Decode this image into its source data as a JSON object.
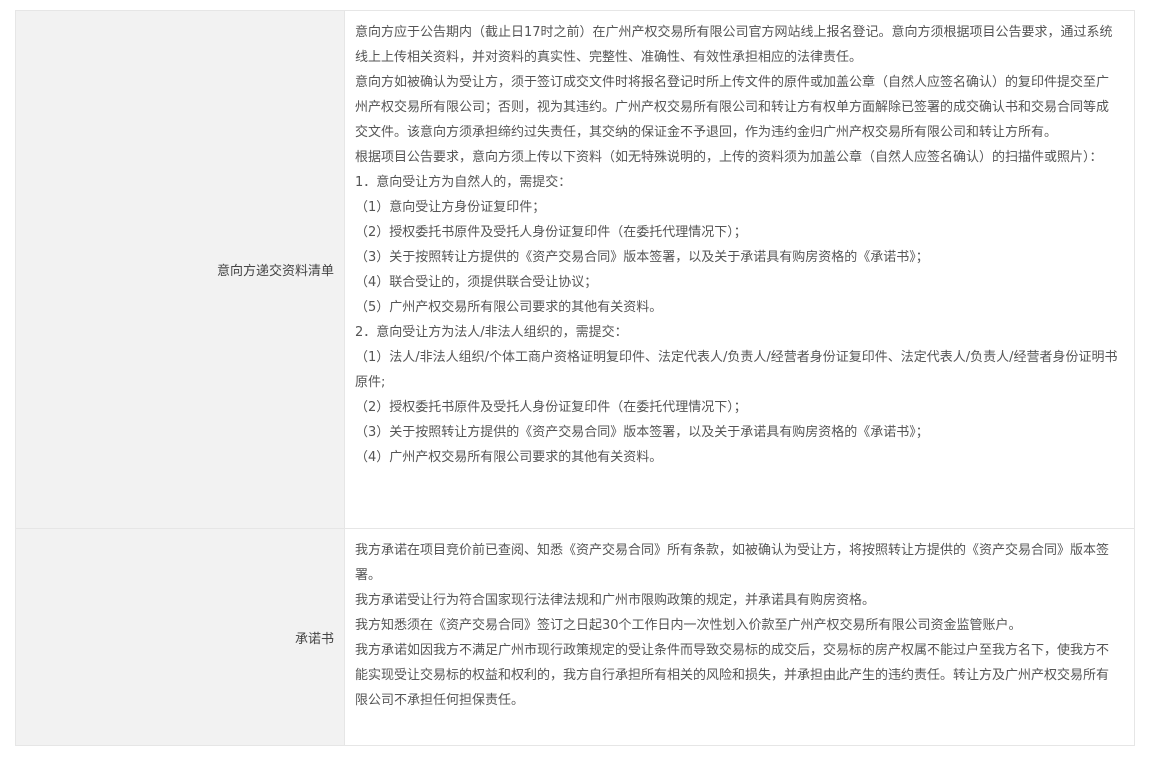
{
  "rows": [
    {
      "label": "意向方递交资料清单",
      "paragraphs": [
        "意向方应于公告期内（截止日17时之前）在广州产权交易所有限公司官方网站线上报名登记。意向方须根据项目公告要求，通过系统线上上传相关资料，并对资料的真实性、完整性、准确性、有效性承担相应的法律责任。",
        "意向方如被确认为受让方，须于签订成交文件时将报名登记时所上传文件的原件或加盖公章（自然人应签名确认）的复印件提交至广州产权交易所有限公司；否则，视为其违约。广州产权交易所有限公司和转让方有权单方面解除已签署的成交确认书和交易合同等成交文件。该意向方须承担缔约过失责任，其交纳的保证金不予退回，作为违约金归广州产权交易所有限公司和转让方所有。",
        "根据项目公告要求，意向方须上传以下资料（如无特殊说明的，上传的资料须为加盖公章（自然人应签名确认）的扫描件或照片）：",
        "1．意向受让方为自然人的，需提交：",
        "（1）意向受让方身份证复印件；",
        "（2）授权委托书原件及受托人身份证复印件（在委托代理情况下）；",
        "（3）关于按照转让方提供的《资产交易合同》版本签署，以及关于承诺具有购房资格的《承诺书》；",
        "（4）联合受让的，须提供联合受让协议；",
        "（5）广州产权交易所有限公司要求的其他有关资料。",
        "2．意向受让方为法人/非法人组织的，需提交：",
        "（1）法人/非法人组织/个体工商户资格证明复印件、法定代表人/负责人/经营者身份证复印件、法定代表人/负责人/经营者身份证明书原件;",
        "（2）授权委托书原件及受托人身份证复印件（在委托代理情况下）；",
        "（3）关于按照转让方提供的《资产交易合同》版本签署，以及关于承诺具有购房资格的《承诺书》；",
        "（4）广州产权交易所有限公司要求的其他有关资料。"
      ]
    },
    {
      "label": "承诺书",
      "paragraphs": [
        "我方承诺在项目竞价前已查阅、知悉《资产交易合同》所有条款，如被确认为受让方，将按照转让方提供的《资产交易合同》版本签署。",
        "我方承诺受让行为符合国家现行法律法规和广州市限购政策的规定，并承诺具有购房资格。",
        "我方知悉须在《资产交易合同》签订之日起30个工作日内一次性划入价款至广州产权交易所有限公司资金监管账户。",
        "我方承诺如因我方不满足广州市现行政策规定的受让条件而导致交易标的成交后，交易标的房产权属不能过户至我方名下，使我方不能实现受让交易标的权益和权利的，我方自行承担所有相关的风险和损失，并承担由此产生的违约责任。转让方及广州产权交易所有限公司不承担任何担保责任。"
      ]
    }
  ]
}
